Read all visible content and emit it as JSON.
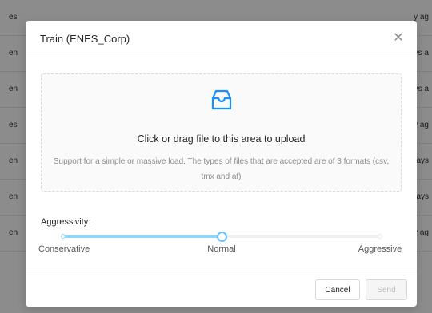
{
  "background_rows": [
    {
      "left": "es",
      "right": "y ag"
    },
    {
      "left": "en",
      "right": "ys a"
    },
    {
      "left": "en",
      "right": "ys a"
    },
    {
      "left": "es",
      "right": "y ag"
    },
    {
      "left": "en",
      "right": "ays"
    },
    {
      "left": "en",
      "right": "ays"
    },
    {
      "left": "en",
      "right": "y ag"
    }
  ],
  "modal": {
    "title": "Train (ENES_Corp)",
    "close_icon": "close-icon",
    "close_glyph": "✕",
    "upload": {
      "icon": "inbox-icon",
      "text": "Click or drag file to this area to upload",
      "hint": "Support for a simple or massive load. The types of files that are accepted are of 3 formats (csv, tmx and af)"
    },
    "aggressivity": {
      "label": "Aggressivity:",
      "marks": [
        "Conservative",
        "Normal",
        "Aggressive"
      ],
      "selected_index": 1,
      "value_fraction": 0.5
    },
    "footer": {
      "cancel_label": "Cancel",
      "send_label": "Send"
    }
  },
  "colors": {
    "accent": "#69c0ff",
    "track": "#91d5ff",
    "icon": "#1890ff"
  }
}
